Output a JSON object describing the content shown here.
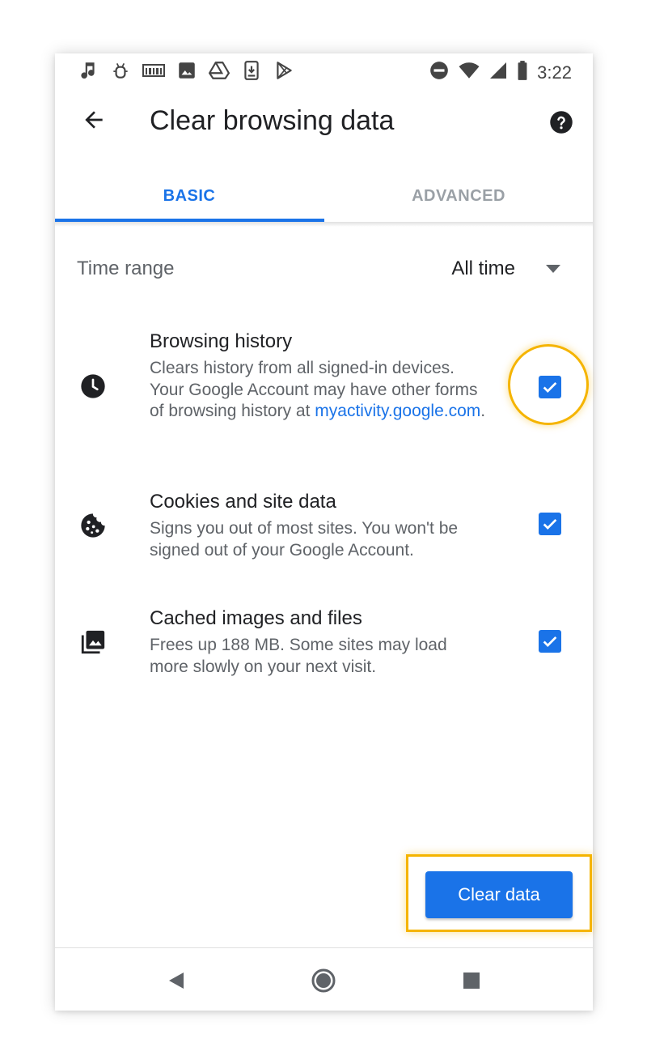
{
  "status_bar": {
    "time": "3:22",
    "left_icons": [
      "music-note-icon",
      "android-debug-icon",
      "barcode-icon",
      "image-icon",
      "drive-icon",
      "download-icon",
      "play-store-icon"
    ],
    "right_icons": [
      "do-not-disturb-icon",
      "wifi-icon",
      "signal-icon",
      "battery-icon"
    ]
  },
  "app_bar": {
    "title": "Clear browsing data"
  },
  "tabs": [
    {
      "label": "BASIC",
      "selected": true
    },
    {
      "label": "ADVANCED",
      "selected": false
    }
  ],
  "time_range": {
    "label": "Time range",
    "value": "All time"
  },
  "options": [
    {
      "title": "Browsing history",
      "description": "Clears history from all signed-in devices. Your Google Account may have other forms of browsing history at ",
      "link": "myactivity.google.com",
      "suffix": ".",
      "icon": "clock-icon",
      "checked": true
    },
    {
      "title": "Cookies and site data",
      "description": "Signs you out of most sites. You won't be signed out of your Google Account.",
      "icon": "cookie-icon",
      "checked": true
    },
    {
      "title": "Cached images and files",
      "description": "Frees up 188 MB. Some sites may load more slowly on your next visit.",
      "icon": "photo-library-icon",
      "checked": true
    }
  ],
  "action": {
    "clear_label": "Clear data"
  },
  "colors": {
    "accent": "#1a73e8",
    "highlight": "#f5b400"
  }
}
